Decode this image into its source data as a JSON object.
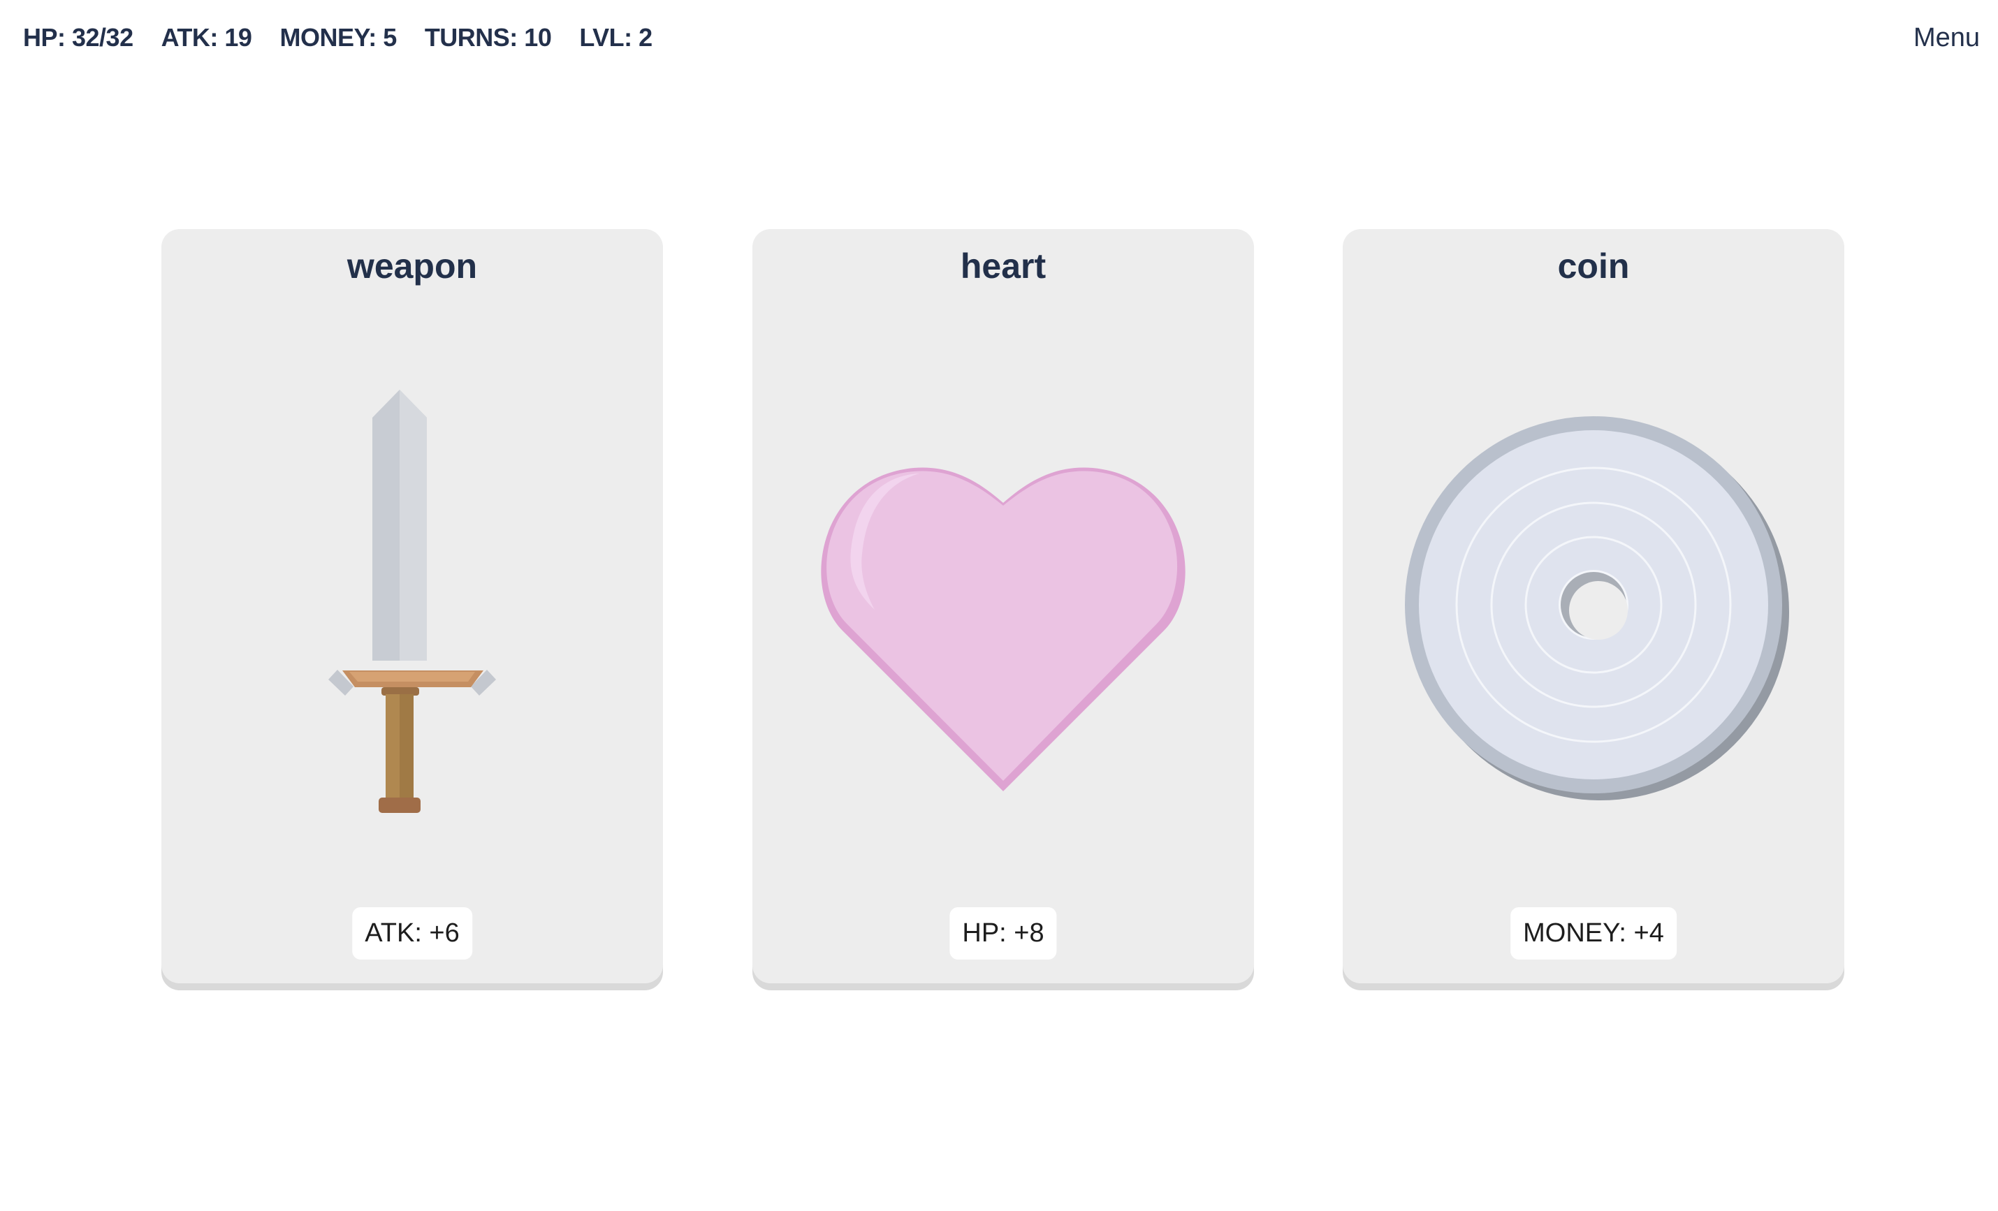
{
  "stats": {
    "hp": "HP: 32/32",
    "atk": "ATK: 19",
    "money": "MONEY: 5",
    "turns": "TURNS: 10",
    "lvl": "LVL: 2"
  },
  "menu_label": "Menu",
  "cards": [
    {
      "title": "weapon",
      "icon": "sword-icon",
      "effect": "ATK: +6"
    },
    {
      "title": "heart",
      "icon": "heart-icon",
      "effect": "HP: +8"
    },
    {
      "title": "coin",
      "icon": "coin-icon",
      "effect": "MONEY: +4"
    }
  ],
  "colors": {
    "text": "#23304b",
    "card_bg": "#ededed",
    "heart": "#ebc3e3",
    "coin": "#dfe3ee",
    "blade": "#c8ccd3",
    "hilt": "#b08850"
  }
}
